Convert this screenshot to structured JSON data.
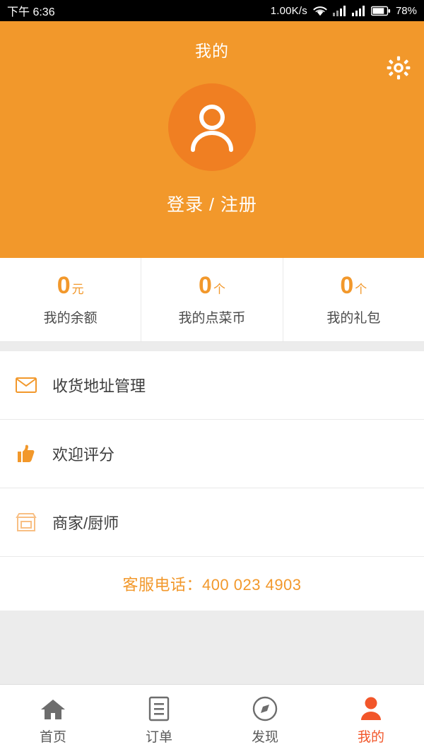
{
  "statusbar": {
    "time": "下午 6:36",
    "net_speed": "1.00K/s",
    "battery_pct": "78%",
    "wifi_icon": "wifi-icon",
    "signal1_icon": "signal-bars-icon",
    "signal2_icon": "signal-bars-icon",
    "battery_icon": "battery-icon"
  },
  "header": {
    "title": "我的",
    "settings_icon": "gear-icon",
    "avatar_icon": "user-avatar-icon",
    "login_label": "登录 / 注册",
    "background_color": "#f2982b"
  },
  "stats": [
    {
      "value": "0",
      "unit": "元",
      "label": "我的余额"
    },
    {
      "value": "0",
      "unit": "个",
      "label": "我的点菜币"
    },
    {
      "value": "0",
      "unit": "个",
      "label": "我的礼包"
    }
  ],
  "menu": [
    {
      "icon": "envelope-icon",
      "label": "收货地址管理"
    },
    {
      "icon": "thumbs-up-icon",
      "label": "欢迎评分"
    },
    {
      "icon": "shop-icon",
      "label": "商家/厨师"
    }
  ],
  "service": {
    "label": "客服电话：400 023 4903",
    "color": "#f2562a"
  },
  "tabbar": [
    {
      "icon": "home-icon",
      "label": "首页",
      "active": false
    },
    {
      "icon": "order-list-icon",
      "label": "订单",
      "active": false
    },
    {
      "icon": "compass-icon",
      "label": "发现",
      "active": false
    },
    {
      "icon": "person-icon",
      "label": "我的",
      "active": true
    }
  ],
  "colors": {
    "accent": "#f2982b",
    "active_tab": "#f2562a",
    "page_bg": "#ececec"
  }
}
